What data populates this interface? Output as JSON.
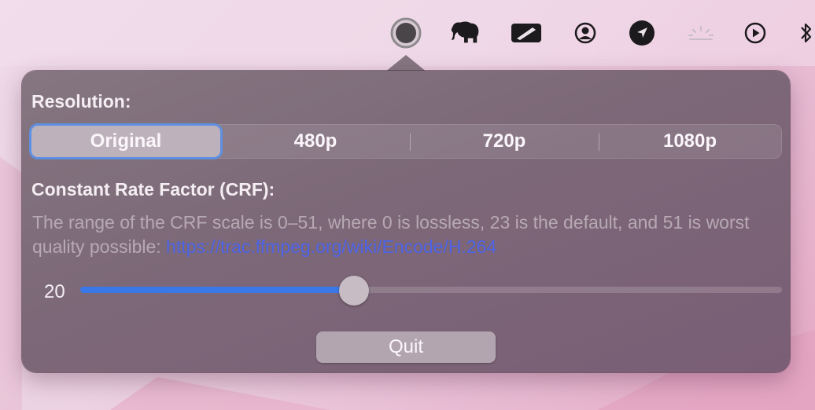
{
  "menubar": {
    "icons": [
      "record-icon",
      "elephant-icon",
      "pen-icon",
      "user-circle-icon",
      "location-arrow-icon",
      "brightness-icon",
      "play-circle-icon",
      "bluetooth-icon"
    ]
  },
  "popover": {
    "resolution_label": "Resolution:",
    "resolution_options": [
      "Original",
      "480p",
      "720p",
      "1080p"
    ],
    "selected_resolution": "Original",
    "crf_label": "Constant Rate Factor (CRF):",
    "crf_description": "The range of the CRF scale is 0–51, where 0 is lossless, 23 is the default, and 51 is worst quality possible: ",
    "crf_link": "https://trac.ffmpeg.org/wiki/Encode/H.264",
    "crf_value": "20",
    "crf_min": 0,
    "crf_max": 51,
    "slider_fraction": 0.39,
    "quit_label": "Quit"
  },
  "colors": {
    "accent": "#3a78e8",
    "link": "#4d63e6",
    "focus_ring": "#5e8fe0"
  }
}
